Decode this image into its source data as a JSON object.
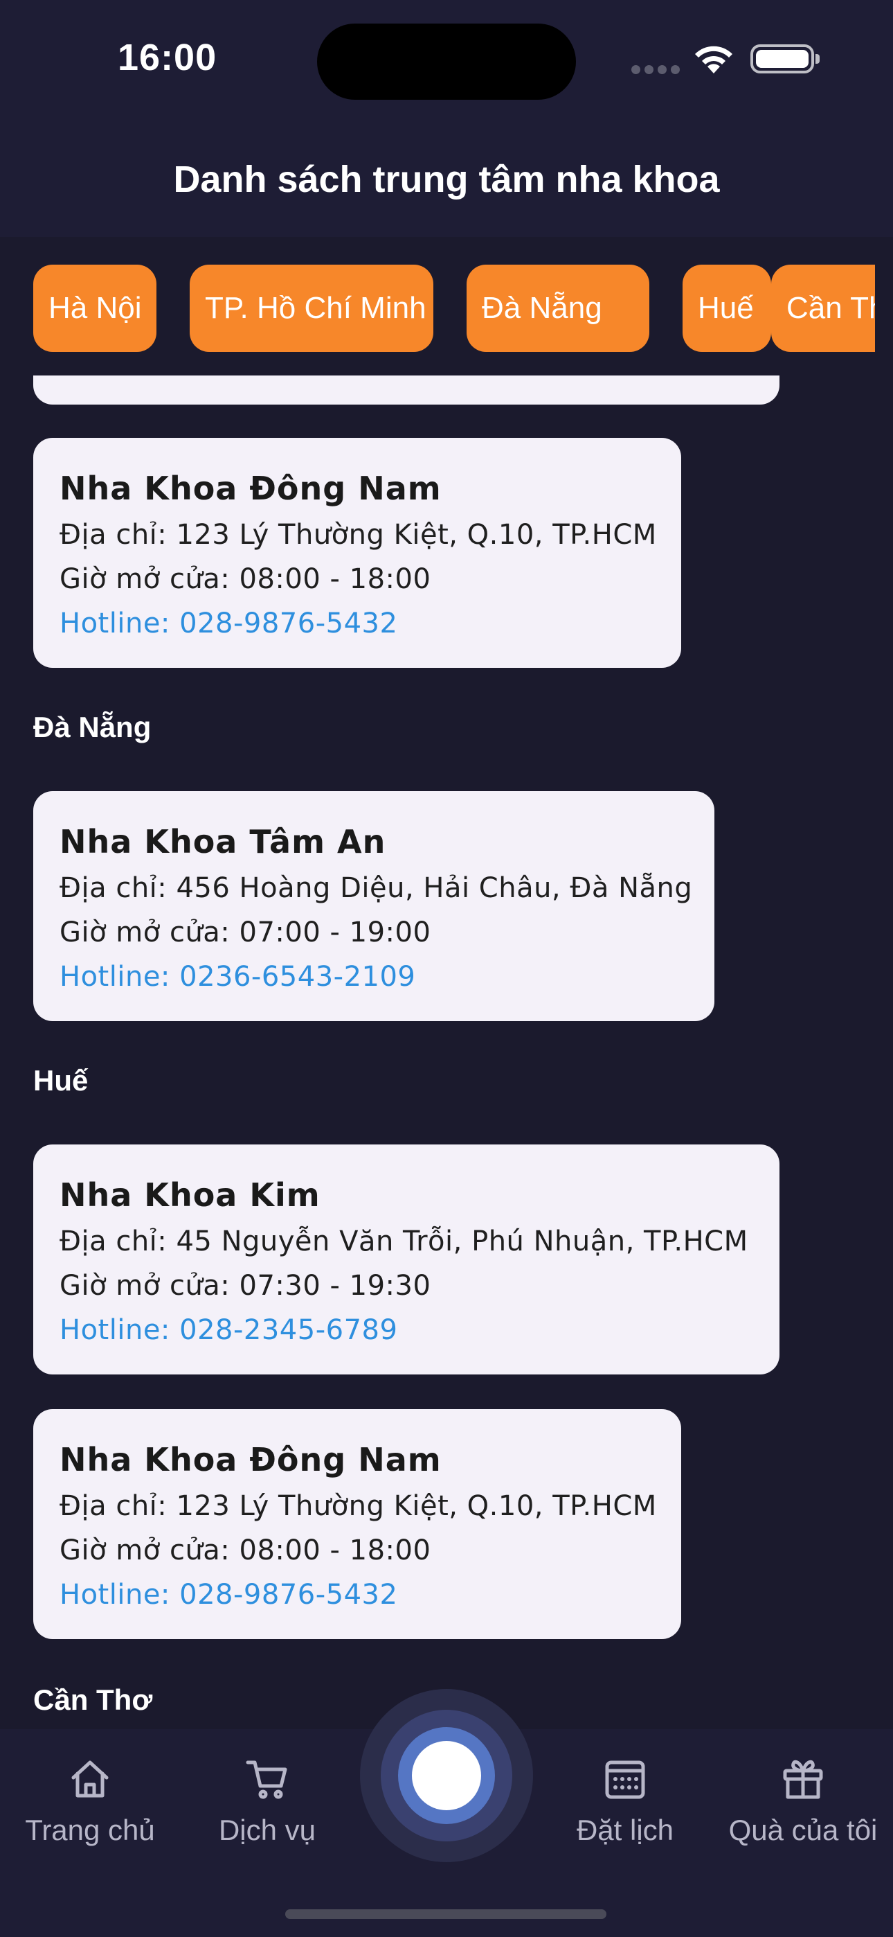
{
  "status_bar": {
    "time": "16:00"
  },
  "header": {
    "title": "Danh sách trung tâm nha khoa"
  },
  "chips": [
    "Hà Nội",
    "TP. Hồ Chí Minh",
    "Đà Nẵng",
    "Huế",
    "Cần Thơ"
  ],
  "cards": [
    {
      "name": "Nha Khoa Đông Nam",
      "address": "Địa chỉ: 123 Lý Thường Kiệt, Q.10, TP.HCM",
      "hours": "Giờ mở cửa: 08:00 - 18:00",
      "hotline": "Hotline: 028-9876-5432"
    },
    {
      "name": "Nha Khoa Tâm An",
      "address": "Địa chỉ: 456 Hoàng Diệu, Hải Châu, Đà Nẵng",
      "hours": "Giờ mở cửa: 07:00 - 19:00",
      "hotline": "Hotline: 0236-6543-2109"
    },
    {
      "name": "Nha Khoa Kim",
      "address": "Địa chỉ: 45 Nguyễn Văn Trỗi, Phú Nhuận, TP.HCM",
      "hours": "Giờ mở cửa: 07:30 - 19:30",
      "hotline": "Hotline: 028-2345-6789"
    },
    {
      "name": "Nha Khoa Đông Nam",
      "address": "Địa chỉ: 123 Lý Thường Kiệt, Q.10, TP.HCM",
      "hours": "Giờ mở cửa: 08:00 - 18:00",
      "hotline": "Hotline: 028-9876-5432"
    }
  ],
  "sections": [
    "Đà Nẵng",
    "Huế",
    "Cần Thơ"
  ],
  "bottom_nav": [
    {
      "label": "Trang chủ",
      "icon": "home-icon"
    },
    {
      "label": "Dịch vụ",
      "icon": "cart-icon"
    },
    {
      "label": "Đặt lịch",
      "icon": "calendar-icon"
    },
    {
      "label": "Quà của tôi",
      "icon": "gift-icon"
    }
  ],
  "colors": {
    "background": "#1b1a2d",
    "header": "#1e1d35",
    "chip": "#f7872a",
    "card": "#f4f1f9",
    "hotline": "#2e8fde",
    "center_button": "#5576c4"
  }
}
